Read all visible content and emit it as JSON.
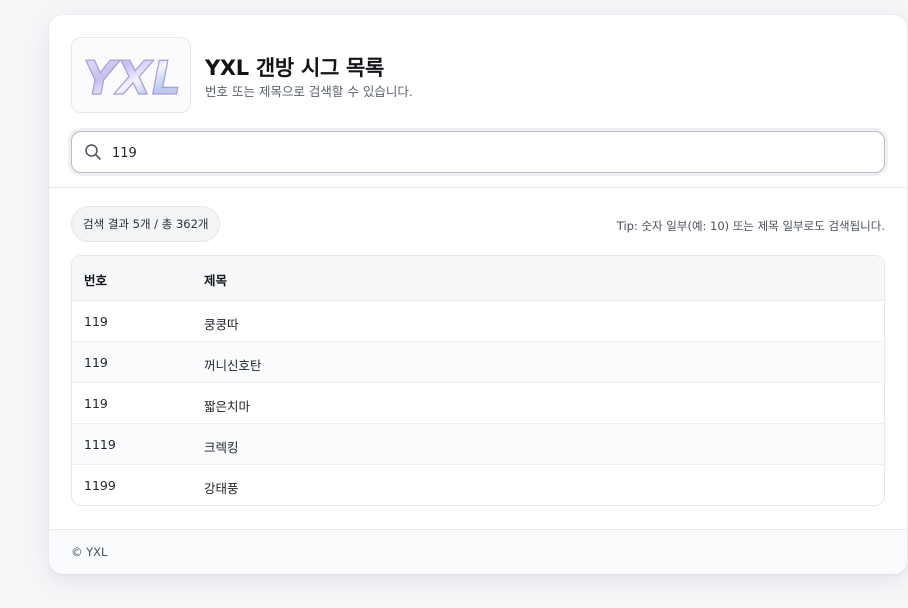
{
  "header": {
    "logo_text": "YXL",
    "title": "YXL 갠방 시그 목록",
    "subtitle": "번호 또는 제목으로 검색할 수 있습니다."
  },
  "search": {
    "value": "119",
    "icon": "search-icon"
  },
  "results": {
    "summary": "검색 결과 5개 / 총 362개",
    "tip": "Tip: 숫자 일부(예: 10) 또는 제목 일부로도 검색됩니다."
  },
  "table": {
    "columns": [
      "번호",
      "제목"
    ],
    "rows": [
      {
        "num": "119",
        "title": "쿵쿵따"
      },
      {
        "num": "119",
        "title": "꺼니신호탄"
      },
      {
        "num": "119",
        "title": "짧은치마"
      },
      {
        "num": "1119",
        "title": "크렉킹"
      },
      {
        "num": "1199",
        "title": "강태풍"
      }
    ]
  },
  "footer": {
    "text": "© YXL"
  },
  "colors": {
    "background": "#f5f6f8",
    "card": "#ffffff",
    "border": "#e6e8ec",
    "text": "#1f2329"
  }
}
